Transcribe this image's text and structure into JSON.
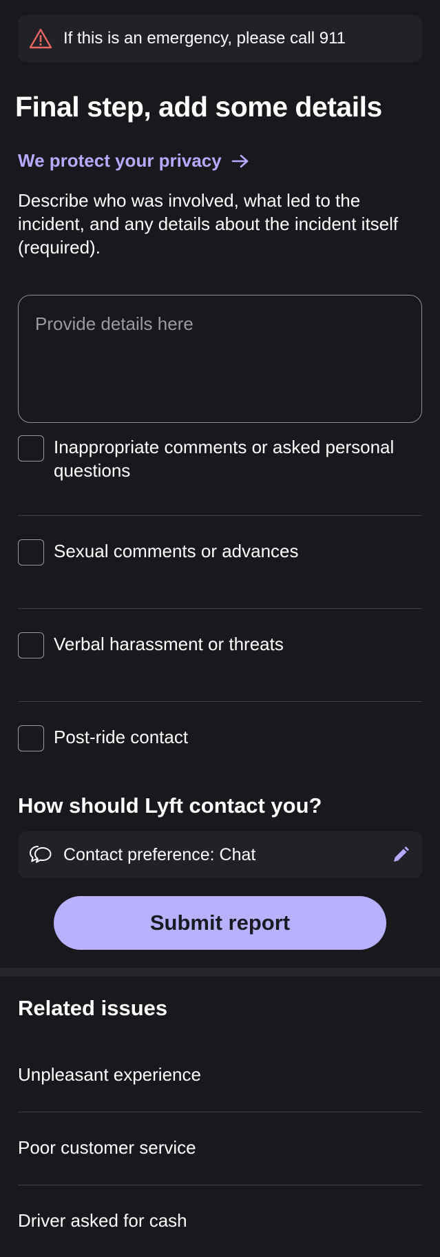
{
  "emergency": {
    "icon": "warning-triangle-icon",
    "icon_color": "#e8675f",
    "text": "If this is an emergency, please call 911"
  },
  "title": "Final step, add some details",
  "privacy_link": {
    "label": "We protect your privacy",
    "icon": "arrow-right-icon",
    "color": "#b7a9ff"
  },
  "description": "Describe who was involved, what led to the incident, and any details about the incident itself (required).",
  "details_input": {
    "placeholder": "Provide details here",
    "value": ""
  },
  "checkboxes": [
    {
      "label": "Inappropriate comments or asked personal questions",
      "checked": false
    },
    {
      "label": "Sexual comments or advances",
      "checked": false
    },
    {
      "label": "Verbal harassment or threats",
      "checked": false
    },
    {
      "label": "Post-ride contact",
      "checked": false
    }
  ],
  "contact": {
    "heading": "How should Lyft contact you?",
    "preference_text": "Contact preference: Chat",
    "chat_icon": "chat-bubbles-icon",
    "edit_icon": "pencil-icon"
  },
  "submit": {
    "label": "Submit report",
    "color": "#b9b0ff"
  },
  "related": {
    "heading": "Related issues",
    "items": [
      "Unpleasant experience",
      "Poor customer service",
      "Driver asked for cash"
    ]
  }
}
